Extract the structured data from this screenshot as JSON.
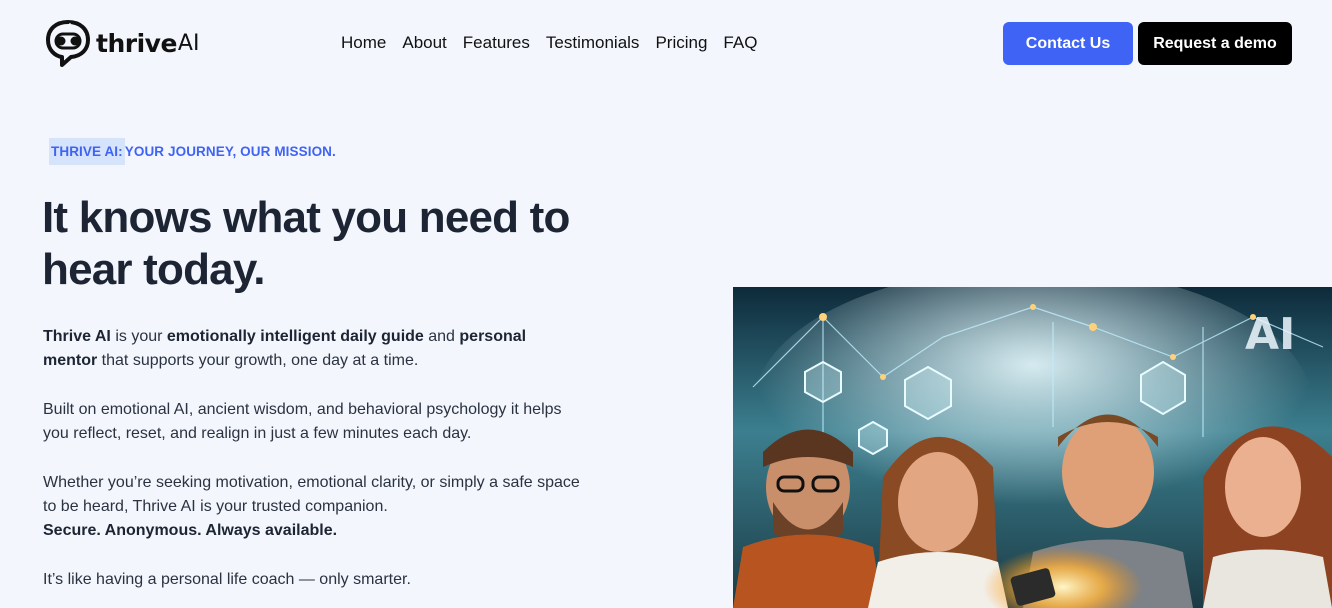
{
  "header": {
    "logo": {
      "word": "thrive",
      "suffix": "AI",
      "icon": "chat-bubble-logo-icon"
    },
    "nav": [
      "Home",
      "About",
      "Features",
      "Testimonials",
      "Pricing",
      "FAQ"
    ],
    "contact_label": "Contact Us",
    "demo_label": "Request a demo",
    "colors": {
      "accent": "#3f63f5",
      "dark": "#000000"
    }
  },
  "hero": {
    "eyebrow_highlight": "THRIVE AI:",
    "eyebrow_rest": " YOUR JOURNEY, OUR MISSION.",
    "headline": "It knows what you need to hear today.",
    "p1": {
      "b1": "Thrive AI",
      "t1": " is your ",
      "b2": "emotionally intelligent daily guide",
      "t2": " and ",
      "b3": "personal mentor",
      "t3": " that supports your growth, one day at a time."
    },
    "p2": "Built on emotional AI, ancient wisdom, and behavioral psychology it helps you reflect, reset, and realign in just a few minutes each day.",
    "p3": {
      "t1": "Whether you’re seeking motivation, emotional clarity, or simply a safe space to be heard, Thrive AI is your trusted companion.",
      "b1": "Secure. Anonymous. Always available."
    },
    "p4": "It’s like having a personal life coach — only smarter.",
    "image": {
      "overlay_text": "AI"
    }
  }
}
